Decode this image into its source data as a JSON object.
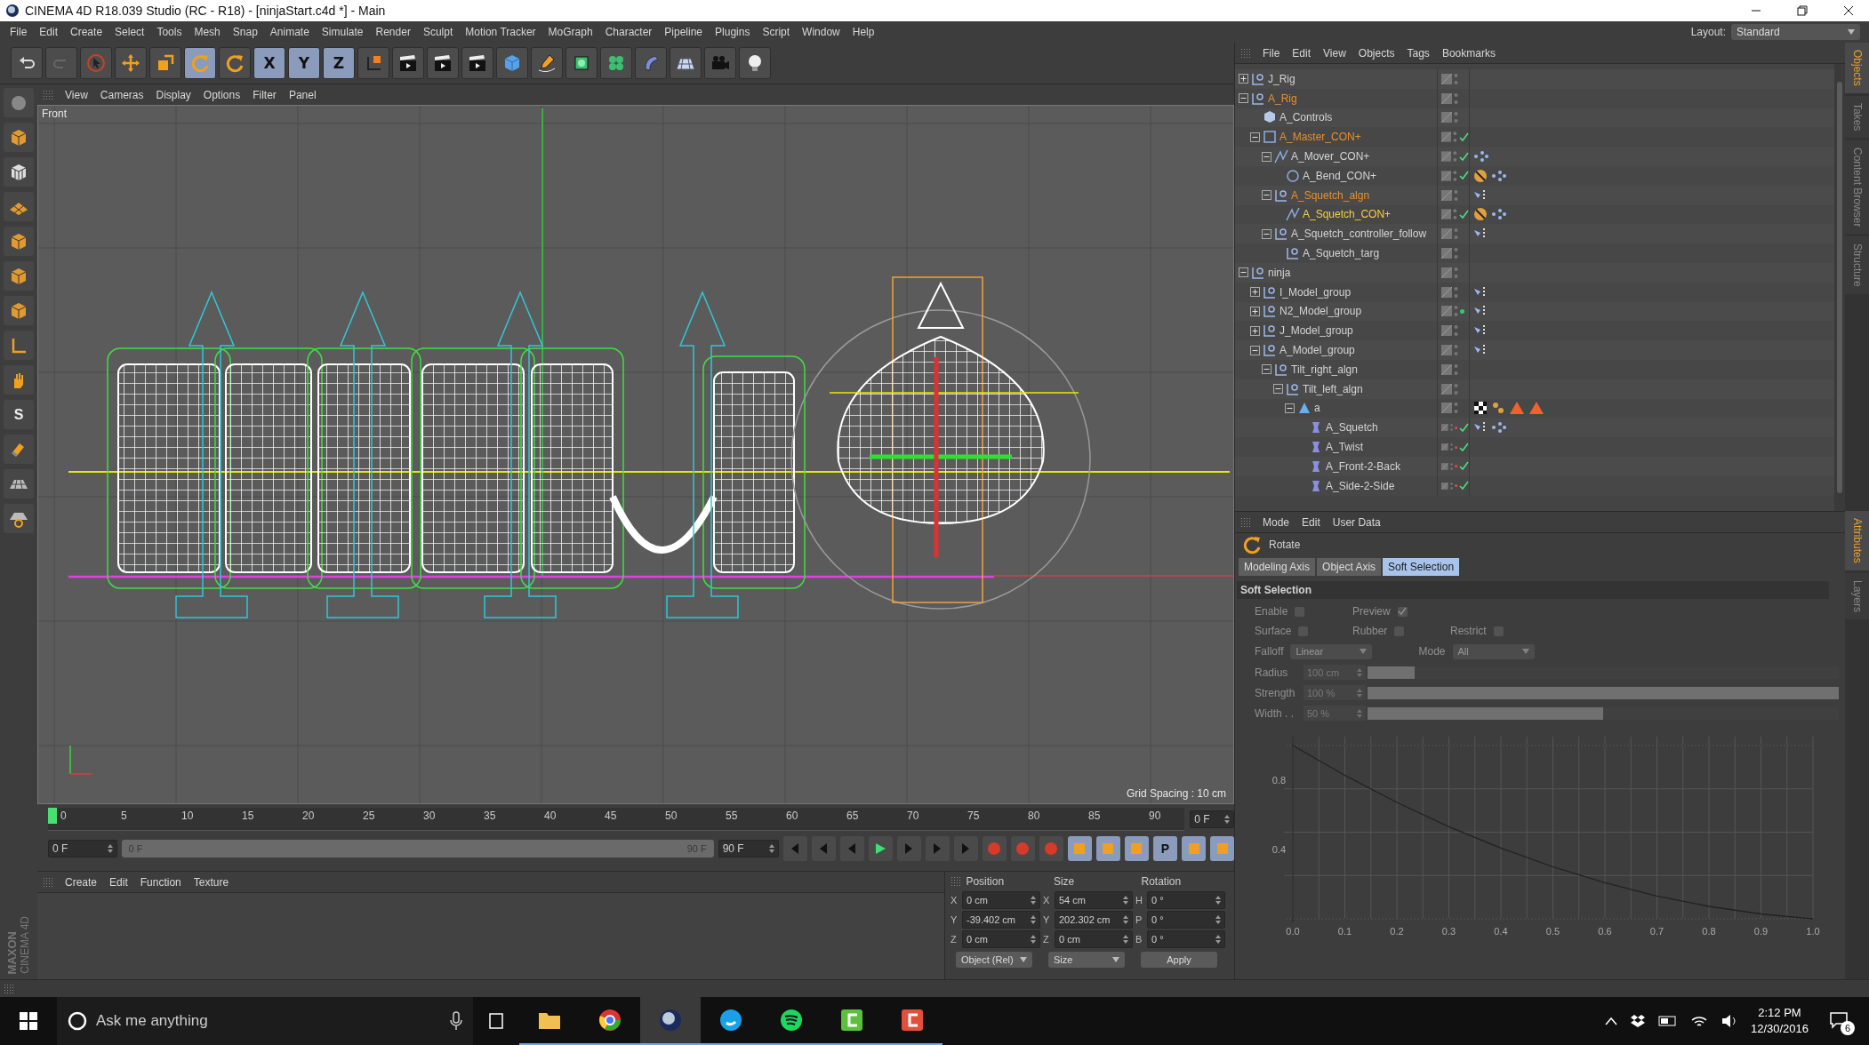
{
  "window": {
    "title": "CINEMA 4D R18.039 Studio (RC - R18) - [ninjaStart.c4d *] - Main"
  },
  "menu": [
    "File",
    "Edit",
    "Create",
    "Select",
    "Tools",
    "Mesh",
    "Snap",
    "Animate",
    "Simulate",
    "Render",
    "Sculpt",
    "Motion Tracker",
    "MoGraph",
    "Character",
    "Pipeline",
    "Plugins",
    "Script",
    "Window",
    "Help"
  ],
  "layout": {
    "label": "Layout:",
    "value": "Standard"
  },
  "toolbar": [
    {
      "kind": "undo",
      "selected": false
    },
    {
      "kind": "redo",
      "selected": false
    },
    {
      "kind": "select",
      "selected": false
    },
    {
      "kind": "move",
      "selected": false
    },
    {
      "kind": "scale",
      "selected": false
    },
    {
      "kind": "rotate",
      "selected": true
    },
    {
      "kind": "rotate",
      "selected": false
    },
    {
      "kind": "axis",
      "label": "X",
      "selected": true
    },
    {
      "kind": "axis",
      "label": "Y",
      "selected": true
    },
    {
      "kind": "axis",
      "label": "Z",
      "selected": true
    },
    {
      "kind": "coords",
      "selected": false
    },
    {
      "kind": "clapper",
      "selected": false
    },
    {
      "kind": "clapper",
      "selected": false
    },
    {
      "kind": "clapper",
      "selected": false
    },
    {
      "kind": "cube",
      "selected": false
    },
    {
      "kind": "pen",
      "selected": false
    },
    {
      "kind": "subdiv",
      "selected": false
    },
    {
      "kind": "cloner",
      "selected": false
    },
    {
      "kind": "deformer",
      "selected": false
    },
    {
      "kind": "floor",
      "selected": false
    },
    {
      "kind": "camera",
      "selected": false
    },
    {
      "kind": "light",
      "selected": false
    }
  ],
  "left_tools": [
    {
      "kind": "sphere"
    },
    {
      "kind": "cube"
    },
    {
      "kind": "checker"
    },
    {
      "kind": "plane"
    },
    {
      "kind": "cube"
    },
    {
      "kind": "cube"
    },
    {
      "kind": "cube"
    },
    {
      "kind": "axis-l"
    },
    {
      "kind": "hand"
    },
    {
      "kind": "letter",
      "label": "S"
    },
    {
      "kind": "magnet"
    },
    {
      "kind": "grid"
    },
    {
      "kind": "grid-lock"
    }
  ],
  "viewport": {
    "menu": [
      "View",
      "Cameras",
      "Display",
      "Options",
      "Filter",
      "Panel"
    ],
    "camera": "Front",
    "grid_spacing": "Grid Spacing : 10 cm"
  },
  "timeline": {
    "ticks": [
      "0",
      "5",
      "10",
      "15",
      "20",
      "25",
      "30",
      "35",
      "40",
      "45",
      "50",
      "55",
      "60",
      "65",
      "70",
      "75",
      "80",
      "85",
      "90"
    ],
    "current": "0 F",
    "start": "0 F",
    "range_start": "0 F",
    "range_end": "90 F",
    "range": {
      "level": 1
    },
    "end": "90 F",
    "key_buttons": [
      {
        "kind": "record",
        "selected": false
      },
      {
        "kind": "autokey",
        "selected": false
      },
      {
        "kind": "keysel",
        "selected": false
      },
      {
        "kind": "move",
        "selected": true
      },
      {
        "kind": "scale",
        "selected": true
      },
      {
        "kind": "rotate",
        "selected": true
      },
      {
        "kind": "param",
        "label": "P",
        "selected": true
      },
      {
        "kind": "points",
        "selected": true
      },
      {
        "kind": "film",
        "selected": true
      }
    ]
  },
  "materials": {
    "menu": [
      "Create",
      "Edit",
      "Function",
      "Texture"
    ]
  },
  "logo": {
    "brand": "MAXON",
    "product": "CINEMA 4D"
  },
  "coordinates": {
    "headers": [
      "Position",
      "Size",
      "Rotation"
    ],
    "rows": [
      {
        "axis": "X",
        "position": "0 cm",
        "size_axis": "X",
        "size": "54 cm",
        "rot_axis": "H",
        "rotation": "0 °"
      },
      {
        "axis": "Y",
        "position": "-39.402 cm",
        "size_axis": "Y",
        "size": "202.302 cm",
        "rot_axis": "P",
        "rotation": "0 °"
      },
      {
        "axis": "Z",
        "position": "0 cm",
        "size_axis": "Z",
        "size": "0 cm",
        "rot_axis": "B",
        "rotation": "0 °"
      }
    ],
    "mode": "Object (Rel)",
    "size_mode": "Size",
    "apply": "Apply"
  },
  "objects": {
    "menu": [
      "File",
      "Edit",
      "View",
      "Objects",
      "Tags",
      "Bookmarks"
    ],
    "tree": [
      {
        "name": "J_Rig",
        "kind": "null",
        "expanded": false,
        "selected": false,
        "checked": false
      },
      {
        "name": "A_Rig",
        "kind": "null",
        "expanded": true,
        "selected": true,
        "checked": false,
        "children": [
          {
            "name": "A_Controls",
            "kind": "polygon",
            "selected": false,
            "checked": false
          },
          {
            "name": "A_Master_CON+",
            "kind": "square",
            "expanded": true,
            "selected": true,
            "checked": true,
            "children": [
              {
                "name": "A_Mover_CON+",
                "kind": "spline",
                "expanded": true,
                "selected": false,
                "checked": true,
                "tags": [
                  {
                    "kind": "chain"
                  }
                ],
                "children": [
                  {
                    "name": "A_Bend_CON+",
                    "kind": "circle",
                    "selected": false,
                    "checked": true,
                    "tags": [
                      {
                        "kind": "protect"
                      },
                      {
                        "kind": "chain"
                      }
                    ]
                  }
                ]
              },
              {
                "name": "A_Squetch_algn",
                "kind": "null",
                "expanded": true,
                "selected": true,
                "checked": false,
                "tags": [
                  {
                    "kind": "constraint"
                  }
                ],
                "children": [
                  {
                    "name": "A_Squetch_CON+",
                    "kind": "spline",
                    "selected": true,
                    "active": true,
                    "checked": true,
                    "tags": [
                      {
                        "kind": "protect"
                      },
                      {
                        "kind": "chain"
                      }
                    ]
                  }
                ]
              },
              {
                "name": "A_Squetch_controller_follow",
                "kind": "null",
                "expanded": true,
                "selected": false,
                "checked": false,
                "tags": [
                  {
                    "kind": "constraint"
                  }
                ],
                "children": [
                  {
                    "name": "A_Squetch_targ",
                    "kind": "null",
                    "selected": false,
                    "checked": false
                  }
                ]
              }
            ]
          }
        ]
      },
      {
        "name": "ninja",
        "kind": "null",
        "expanded": true,
        "selected": false,
        "checked": false,
        "children": [
          {
            "name": "I_Model_group",
            "kind": "null",
            "expanded": false,
            "selected": false,
            "checked": false,
            "tags": [
              {
                "kind": "constraint"
              }
            ]
          },
          {
            "name": "N2_Model_group",
            "kind": "null",
            "expanded": false,
            "selected": false,
            "checked": false,
            "color": "#2ecc71",
            "tags": [
              {
                "kind": "constraint"
              }
            ]
          },
          {
            "name": "J_Model_group",
            "kind": "null",
            "expanded": false,
            "selected": false,
            "checked": false,
            "tags": [
              {
                "kind": "constraint"
              }
            ]
          },
          {
            "name": "A_Model_group",
            "kind": "null",
            "expanded": true,
            "selected": false,
            "checked": false,
            "tags": [
              {
                "kind": "constraint"
              }
            ],
            "children": [
              {
                "name": "Tilt_right_algn",
                "kind": "null",
                "expanded": true,
                "selected": false,
                "checked": false,
                "children": [
                  {
                    "name": "Tilt_left_algn",
                    "kind": "null",
                    "expanded": true,
                    "selected": false,
                    "checked": false,
                    "children": [
                      {
                        "name": "a",
                        "kind": "mesh",
                        "expanded": true,
                        "selected": false,
                        "checked": false,
                        "tags": [
                          {
                            "kind": "checker"
                          },
                          {
                            "kind": "weights"
                          },
                          {
                            "kind": "triangle"
                          },
                          {
                            "kind": "triangle"
                          }
                        ],
                        "children": [
                          {
                            "name": "A_Squetch",
                            "kind": "deformer",
                            "selected": false,
                            "checked": true,
                            "color": "#e04848",
                            "tags": [
                              {
                                "kind": "constraint"
                              },
                              {
                                "kind": "chain"
                              }
                            ]
                          },
                          {
                            "name": "A_Twist",
                            "kind": "deformer",
                            "selected": false,
                            "checked": true,
                            "color": "#e04848"
                          },
                          {
                            "name": "A_Front-2-Back",
                            "kind": "deformer",
                            "selected": false,
                            "checked": true,
                            "color": "#e04848"
                          },
                          {
                            "name": "A_Side-2-Side",
                            "kind": "deformer",
                            "selected": false,
                            "checked": true,
                            "color": "#e04848"
                          }
                        ]
                      }
                    ]
                  }
                ]
              }
            ]
          }
        ]
      }
    ]
  },
  "attributes": {
    "menu": [
      "Mode",
      "Edit",
      "User Data"
    ],
    "tool": "Rotate",
    "tabs": [
      {
        "label": "Modeling Axis",
        "selected": false
      },
      {
        "label": "Object Axis",
        "selected": false
      },
      {
        "label": "Soft Selection",
        "selected": true
      }
    ],
    "section": "Soft Selection",
    "disabled": true,
    "checkbox_rows": [
      [
        {
          "label": "Enable",
          "checked": false
        },
        {
          "label": "Preview",
          "checked": true
        }
      ],
      [
        {
          "label": "Surface",
          "checked": false
        },
        {
          "label": "Rubber",
          "checked": false
        },
        {
          "label": "Restrict",
          "checked": false
        }
      ]
    ],
    "dropdowns": [
      {
        "label": "Falloff",
        "value": "Linear"
      },
      {
        "label": "Mode",
        "value": "All"
      }
    ],
    "sliders": [
      {
        "label": "Radius",
        "value": "100 cm",
        "level": 0.1
      },
      {
        "label": "Strength",
        "value": "100 %",
        "level": 1
      },
      {
        "label": "Width . .",
        "value": "50 %",
        "level": 0.5
      }
    ],
    "chart_data": {
      "type": "line",
      "grid": true,
      "x": [
        0,
        0.1,
        0.2,
        0.3,
        0.4,
        0.5,
        0.6,
        0.7,
        0.8,
        0.9,
        1
      ],
      "values": [
        1,
        0.828,
        0.672,
        0.532,
        0.408,
        0.3,
        0.208,
        0.132,
        0.072,
        0.028,
        0
      ],
      "xlim": [
        0,
        1
      ],
      "ylim": [
        0,
        1
      ],
      "xticks": [
        {
          "value": 0,
          "label": "0.0"
        },
        {
          "value": 0.1,
          "label": "0.1"
        },
        {
          "value": 0.2,
          "label": "0.2"
        },
        {
          "value": 0.3,
          "label": "0.3"
        },
        {
          "value": 0.4,
          "label": "0.4"
        },
        {
          "value": 0.5,
          "label": "0.5"
        },
        {
          "value": 0.6,
          "label": "0.6"
        },
        {
          "value": 0.7,
          "label": "0.7"
        },
        {
          "value": 0.8,
          "label": "0.8"
        },
        {
          "value": 0.9,
          "label": "0.9"
        },
        {
          "value": 1,
          "label": "1.0"
        }
      ],
      "yticks": [
        0.4,
        0.8
      ]
    }
  },
  "side_tabs_top": [
    {
      "label": "Objects",
      "selected": true
    },
    {
      "label": "Takes",
      "selected": false
    },
    {
      "label": "Content Browser",
      "selected": false
    },
    {
      "label": "Structure",
      "selected": false
    }
  ],
  "side_tabs_bottom": [
    {
      "label": "Attributes",
      "selected": true
    },
    {
      "label": "Layers",
      "selected": false
    }
  ],
  "taskbar": {
    "search": "Ask me anything",
    "apps": [
      {
        "kind": "folder",
        "selected": false
      },
      {
        "kind": "chrome",
        "selected": false
      },
      {
        "kind": "cinema",
        "selected": true
      },
      {
        "kind": "skype",
        "selected": false
      },
      {
        "kind": "spotify",
        "selected": false
      },
      {
        "kind": "green",
        "selected": false
      },
      {
        "kind": "red",
        "selected": false
      }
    ],
    "time": "2:12 PM",
    "date": "12/30/2016",
    "notifications": "6"
  }
}
